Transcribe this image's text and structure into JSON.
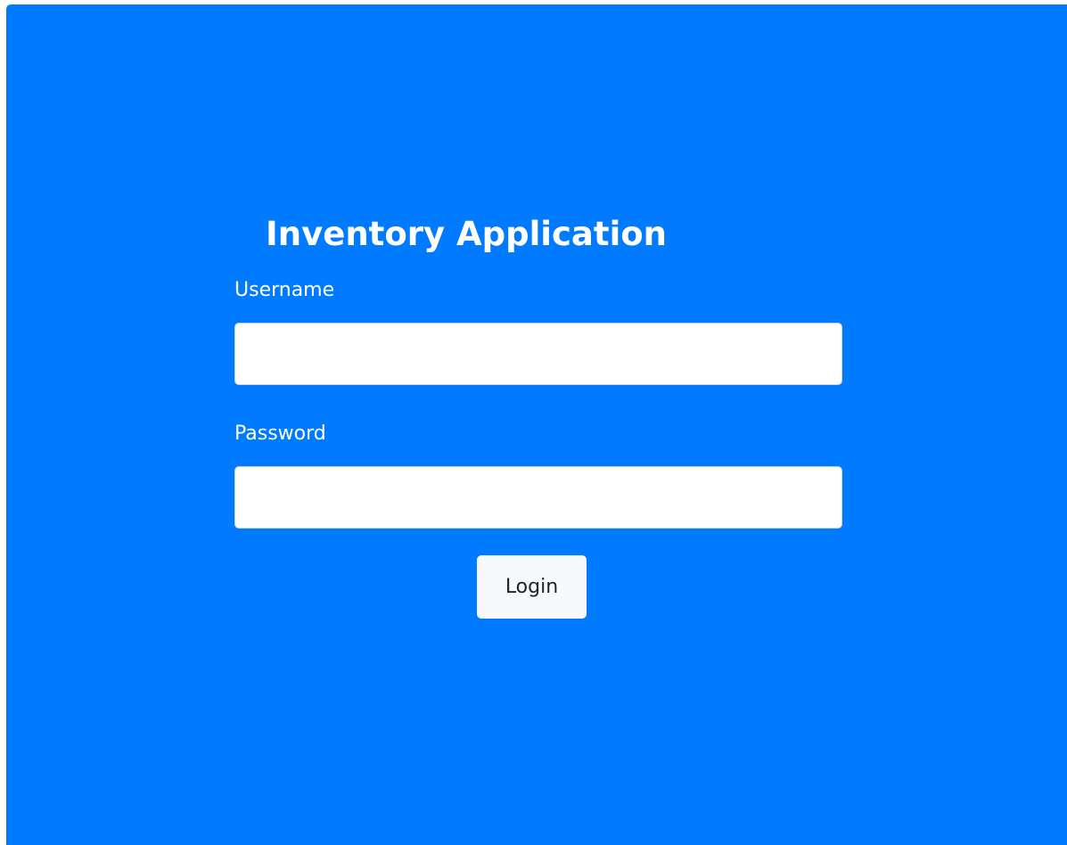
{
  "app": {
    "title": "Inventory Application"
  },
  "form": {
    "username": {
      "label": "Username",
      "value": "",
      "placeholder": ""
    },
    "password": {
      "label": "Password",
      "value": "",
      "placeholder": ""
    },
    "login_label": "Login"
  },
  "colors": {
    "background": "#007bff",
    "panel_text": "#ffffff",
    "button_background": "#f8f9fa",
    "button_text": "#212529"
  }
}
